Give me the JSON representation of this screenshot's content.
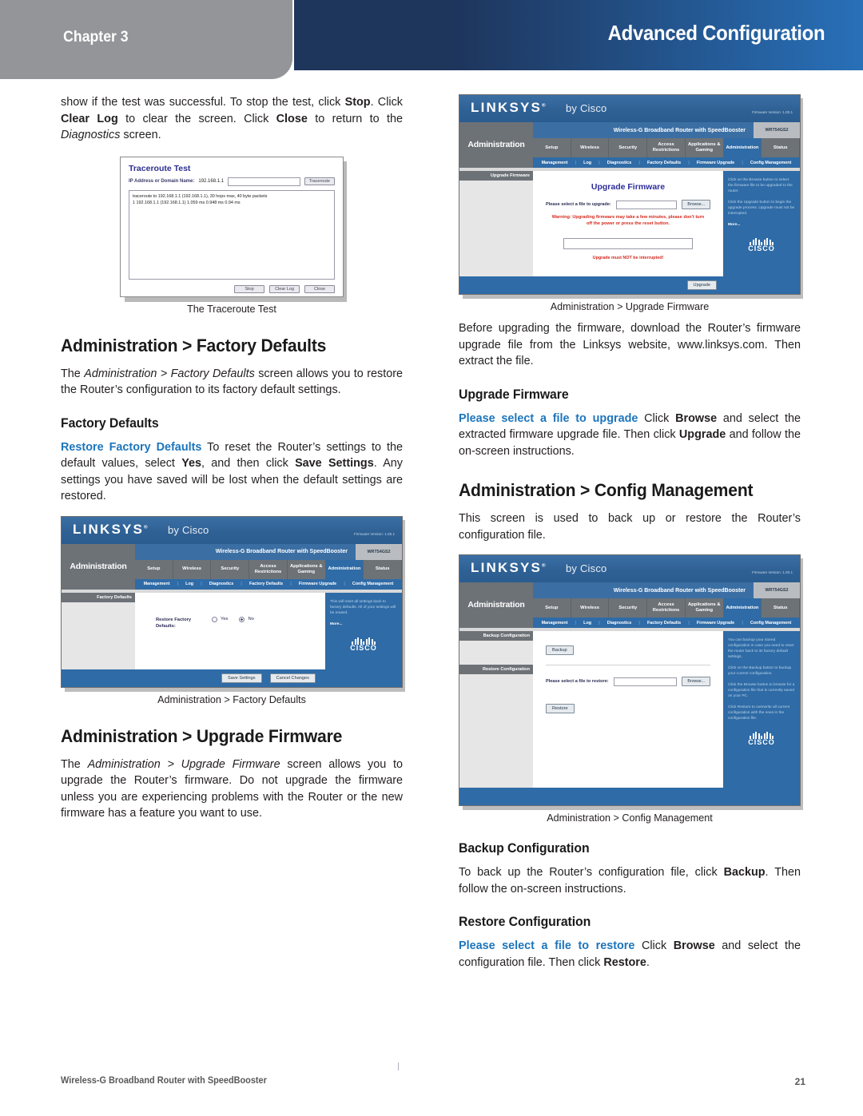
{
  "header": {
    "chapter_label": "Chapter 3",
    "title": "Advanced Configuration",
    "band_color_left": "#1e355c",
    "band_color_right": "#2870b8",
    "chapter_bg": "#939598"
  },
  "accent_color": "#1c75bc",
  "left_column": {
    "intro_paragraph": {
      "p1": "show if the test was successful. To stop the test, click ",
      "b1": "Stop",
      "p2": ". Click ",
      "b2": "Clear Log",
      "p3": " to clear the screen. Click ",
      "b3": "Close",
      "p4": " to return to the ",
      "i1": "Diagnostics",
      "p5": " screen."
    },
    "traceroute_figure": {
      "dialog_title": "Traceroute Test",
      "field_label": "IP Address or Domain Name:",
      "field_value": "192.168.1.1",
      "traceroute_button": "Traceroute",
      "log_line_1": "traceroute to 192.168.1.1 (192.168.1.1), 30 hops max, 40 byte packets",
      "log_line_2": "1  192.168.1.1 (192.168.1.1)  1.059 ms  0.948 ms  0.94 ms",
      "stop_button": "Stop",
      "clear_log_button": "Clear Log",
      "close_button": "Close",
      "caption": "The Traceroute Test"
    },
    "section_factory_defaults": {
      "heading": "Administration > Factory Defaults",
      "paragraph": {
        "p1": "The ",
        "i1": "Administration > Factory Defaults",
        "p2": " screen allows you to restore the Router’s configuration to its factory default settings."
      },
      "subheading": "Factory Defaults",
      "restore_paragraph": {
        "accent": "Restore Factory Defaults",
        "p1": "  To reset the Router’s settings to the default values, select ",
        "b1": "Yes",
        "p2": ", and then click ",
        "b2": "Save Settings",
        "p3": ". Any settings you have saved will be lost when the default settings are restored."
      },
      "figure_caption": "Administration > Factory Defaults"
    },
    "section_upgrade_firmware": {
      "heading": "Administration > Upgrade Firmware",
      "paragraph": {
        "p1": "The ",
        "i1": "Administration > Upgrade Firmware",
        "p2": " screen allows you to upgrade the Router’s firmware. Do not upgrade the firmware unless you are experiencing problems with the Router or the new firmware has a feature you want to use."
      }
    }
  },
  "right_column": {
    "upgrade_firmware_figure_caption": "Administration > Upgrade Firmware",
    "before_paragraph": "Before upgrading the firmware, download the Router’s firmware upgrade file from the Linksys website, www.linksys.com. Then extract the file.",
    "upgrade_firmware_subheading": "Upgrade Firmware",
    "upgrade_firmware_paragraph": {
      "accent": "Please select a file to upgrade",
      "p1": "  Click ",
      "b1": "Browse",
      "p2": " and select the extracted firmware upgrade file. Then click ",
      "b2": "Upgrade",
      "p3": " and follow the on-screen instructions."
    },
    "section_config_management": {
      "heading": "Administration > Config Management",
      "paragraph": "This screen is used to back up or restore the Router’s configuration file.",
      "figure_caption": "Administration > Config Management"
    },
    "backup_configuration": {
      "subheading": "Backup Configuration",
      "paragraph": {
        "p1": "To back up the Router’s configuration file, click ",
        "b1": "Backup",
        "p2": ". Then follow the on-screen instructions."
      }
    },
    "restore_configuration": {
      "subheading": "Restore Configuration",
      "paragraph": {
        "accent": "Please select a file to restore",
        "p1": "  Click ",
        "b1": "Browse",
        "p2": " and select the configuration file. Then click ",
        "b2": "Restore",
        "p3": "."
      }
    }
  },
  "router_ui": {
    "brand": "LINKSYS",
    "brand_reg": "®",
    "by_cisco": "by Cisco",
    "firmware_version": "Firmware Version: 1.00.1",
    "model_title": "Wireless-G Broadband Router with SpeedBooster",
    "model_number": "WRT54GS2",
    "section_label": "Administration",
    "tabs": [
      "Setup",
      "Wireless",
      "Security",
      "Access Restrictions",
      "Applications & Gaming",
      "Administration",
      "Status"
    ],
    "subtabs": [
      "Management",
      "Log",
      "Diagnostics",
      "Factory Defaults",
      "Firmware Upgrade",
      "Config Management"
    ],
    "cisco_logo_text": "CISCO"
  },
  "factory_defaults_screen": {
    "sidebar_item": "Factory Defaults",
    "field_label": "Restore Factory Defaults:",
    "option_yes": "Yes",
    "option_no": "No",
    "selected_option": "No",
    "help_text": "This will reset all settings back to factory defaults. All of your settings will be erased.",
    "help_more": "More...",
    "save_button": "Save Settings",
    "cancel_button": "Cancel Changes"
  },
  "upgrade_firmware_screen": {
    "sidebar_item": "Upgrade Firmware",
    "panel_title": "Upgrade Firmware",
    "field_label": "Please select a file to upgrade:",
    "browse_button": "Browse...",
    "warning_prefix": "Warning:",
    "warning_text": " Upgrading firmware may take a few minutes, please don't turn off the power or press the reset button.",
    "interrupt_text": "Upgrade must NOT be interrupted!",
    "help_text_1": "Click on the Browse button to select the firmware file to be upgraded to the router.",
    "help_text_2": "Click the Upgrade button to begin the upgrade process. Upgrade must not be interrupted.",
    "help_more": "More...",
    "upgrade_button": "Upgrade"
  },
  "config_management_screen": {
    "sidebar_item_backup": "Backup Configuration",
    "sidebar_item_restore": "Restore Configuration",
    "backup_button": "Backup",
    "restore_field_label": "Please select a file to restore:",
    "browse_button": "Browse...",
    "restore_button": "Restore",
    "help_text_1": "You can backup your stored configuration in case you need to reset the router back to its factory default settings.",
    "help_text_2": "Click on the Backup button to backup your current configuration.",
    "help_text_3": "Click the Browse button to browse for a configuration file that is currently saved on your PC.",
    "help_text_4": "Click Restore to overwrite all current configuration with the ones in the configuration file."
  },
  "footer": {
    "left_text": "Wireless-G Broadband Router with SpeedBooster",
    "page_number": "21"
  }
}
